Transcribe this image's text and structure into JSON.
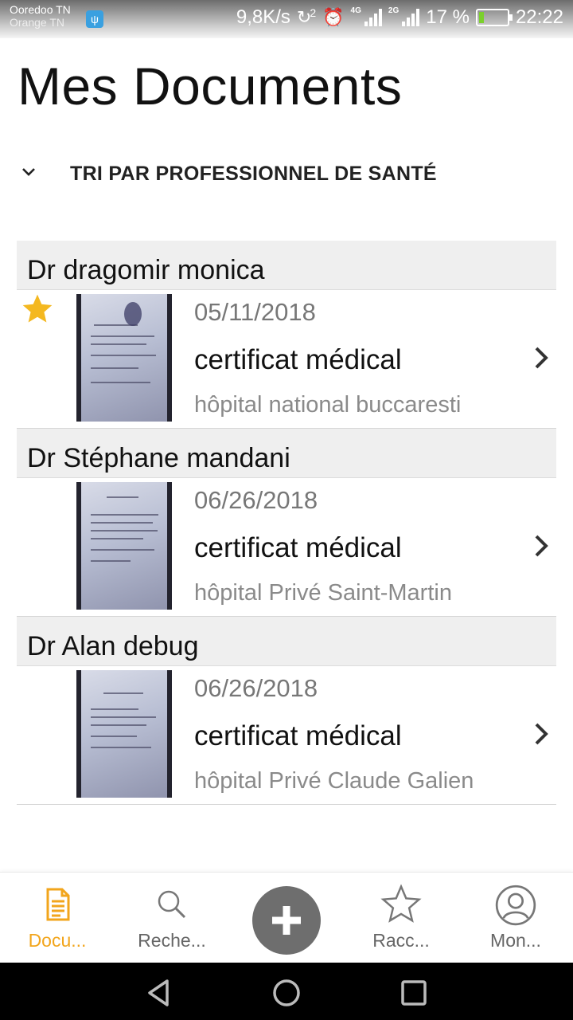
{
  "status_bar": {
    "carrier_1": "Ooredoo TN",
    "carrier_2": "Orange TN",
    "speed": "9,8K/s",
    "sim_badge": "2",
    "net_1": "4G",
    "net_2": "2G",
    "battery_percent": "17 %",
    "battery_level": 0.17,
    "time": "22:22",
    "icons": [
      "usb-icon",
      "sync-icon",
      "alarm-icon",
      "signal-icon",
      "battery-charging-icon"
    ]
  },
  "page": {
    "title": "Mes Documents"
  },
  "sort": {
    "label": "TRI PAR PROFESSIONNEL DE SANTÉ",
    "icon": "chevron-down-icon"
  },
  "groups": [
    {
      "doctor": "Dr dragomir monica",
      "documents": [
        {
          "date": "05/11/2018",
          "type": "certificat médical",
          "place": "hôpital national buccaresti",
          "favorite": true
        }
      ]
    },
    {
      "doctor": "Dr Stéphane mandani",
      "documents": [
        {
          "date": "06/26/2018",
          "type": "certificat médical",
          "place": "hôpital Privé Saint-Martin",
          "favorite": false
        }
      ]
    },
    {
      "doctor": "Dr Alan debug",
      "documents": [
        {
          "date": "06/26/2018",
          "type": "certificat médical",
          "place": "hôpital Privé Claude Galien",
          "favorite": false
        }
      ]
    }
  ],
  "bottom_nav": {
    "items": [
      {
        "label": "Docu...",
        "icon": "document-icon",
        "active": true
      },
      {
        "label": "Reche...",
        "icon": "search-icon",
        "active": false
      },
      {
        "label": "",
        "icon": "plus-icon",
        "active": false
      },
      {
        "label": "Racc...",
        "icon": "star-outline-icon",
        "active": false
      },
      {
        "label": "Mon...",
        "icon": "user-circle-icon",
        "active": false
      }
    ]
  },
  "colors": {
    "accent": "#f2a51c",
    "star": "#f4b820",
    "fab": "#6e6e6e",
    "group_header_bg": "#efefef"
  }
}
